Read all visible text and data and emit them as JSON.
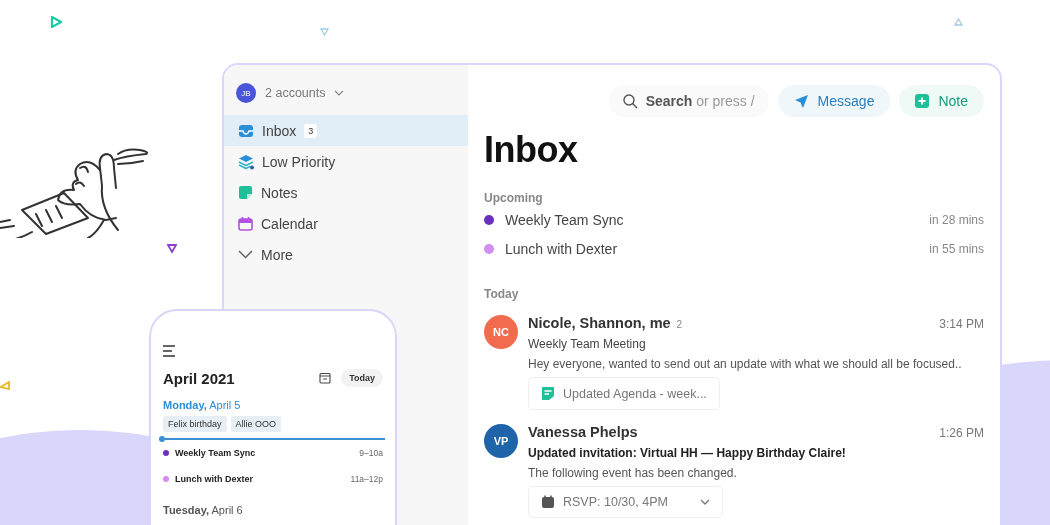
{
  "account": {
    "initials": "JB",
    "label": "2 accounts"
  },
  "sidebar": {
    "items": [
      {
        "label": "Inbox",
        "badge": "3",
        "kind": "inbox",
        "selected": true
      },
      {
        "label": "Low Priority",
        "kind": "layers",
        "selected": false
      },
      {
        "label": "Notes",
        "kind": "note",
        "selected": false
      },
      {
        "label": "Calendar",
        "kind": "calendar",
        "selected": false
      },
      {
        "label": "More",
        "kind": "more",
        "selected": false
      }
    ]
  },
  "toolbar": {
    "search": "**Search** or press /",
    "buttons": [
      {
        "label": "Message",
        "kind": "message"
      },
      {
        "label": "Note",
        "kind": "note"
      }
    ]
  },
  "title": "Inbox",
  "upcoming": {
    "heading": "Upcoming",
    "events": [
      {
        "title": "Weekly Team Sync",
        "time": "in 28 mins",
        "color": "#6b2fc0"
      },
      {
        "title": "Lunch with Dexter",
        "time": "in 55 mins",
        "color": "#d48ef0"
      }
    ]
  },
  "today": {
    "heading": "Today",
    "messages": [
      {
        "initials": "NC",
        "color": "#f26b4f",
        "sender": "Nicole, Shannon, me",
        "count": "2",
        "time": "3:14 PM",
        "subject": "Weekly Team Meeting",
        "unread": false,
        "preview": "Hey everyone, wanted to send out an update with what we should all be focused..",
        "attachment": {
          "kind": "note",
          "label": "Updated Agenda - week..."
        }
      },
      {
        "initials": "VP",
        "color": "#1f64a8",
        "sender": "Vanessa Phelps",
        "time": "1:26 PM",
        "subject": "Updated invitation: Virtual HH — Happy Birthday Claire!",
        "unread": true,
        "preview": "The following event has been changed.",
        "attachment": {
          "kind": "event",
          "label": "RSVP: 10/30, 4PM"
        }
      }
    ]
  },
  "phone": {
    "title": "April 2021",
    "today_button": "Today",
    "days": [
      {
        "weekday": "Monday,",
        "date": "April 5",
        "current": true,
        "all_day": [
          "Felix birthday",
          "Allie OOO"
        ],
        "events": [
          {
            "title": "Weekly Team Sync",
            "time": "9–10a",
            "color": "#6b2fc0"
          },
          {
            "title": "Lunch with Dexter",
            "time": "11a–12p",
            "color": "#d48ef0"
          }
        ]
      },
      {
        "weekday": "Tuesday,",
        "date": "April 6",
        "current": false
      }
    ]
  }
}
